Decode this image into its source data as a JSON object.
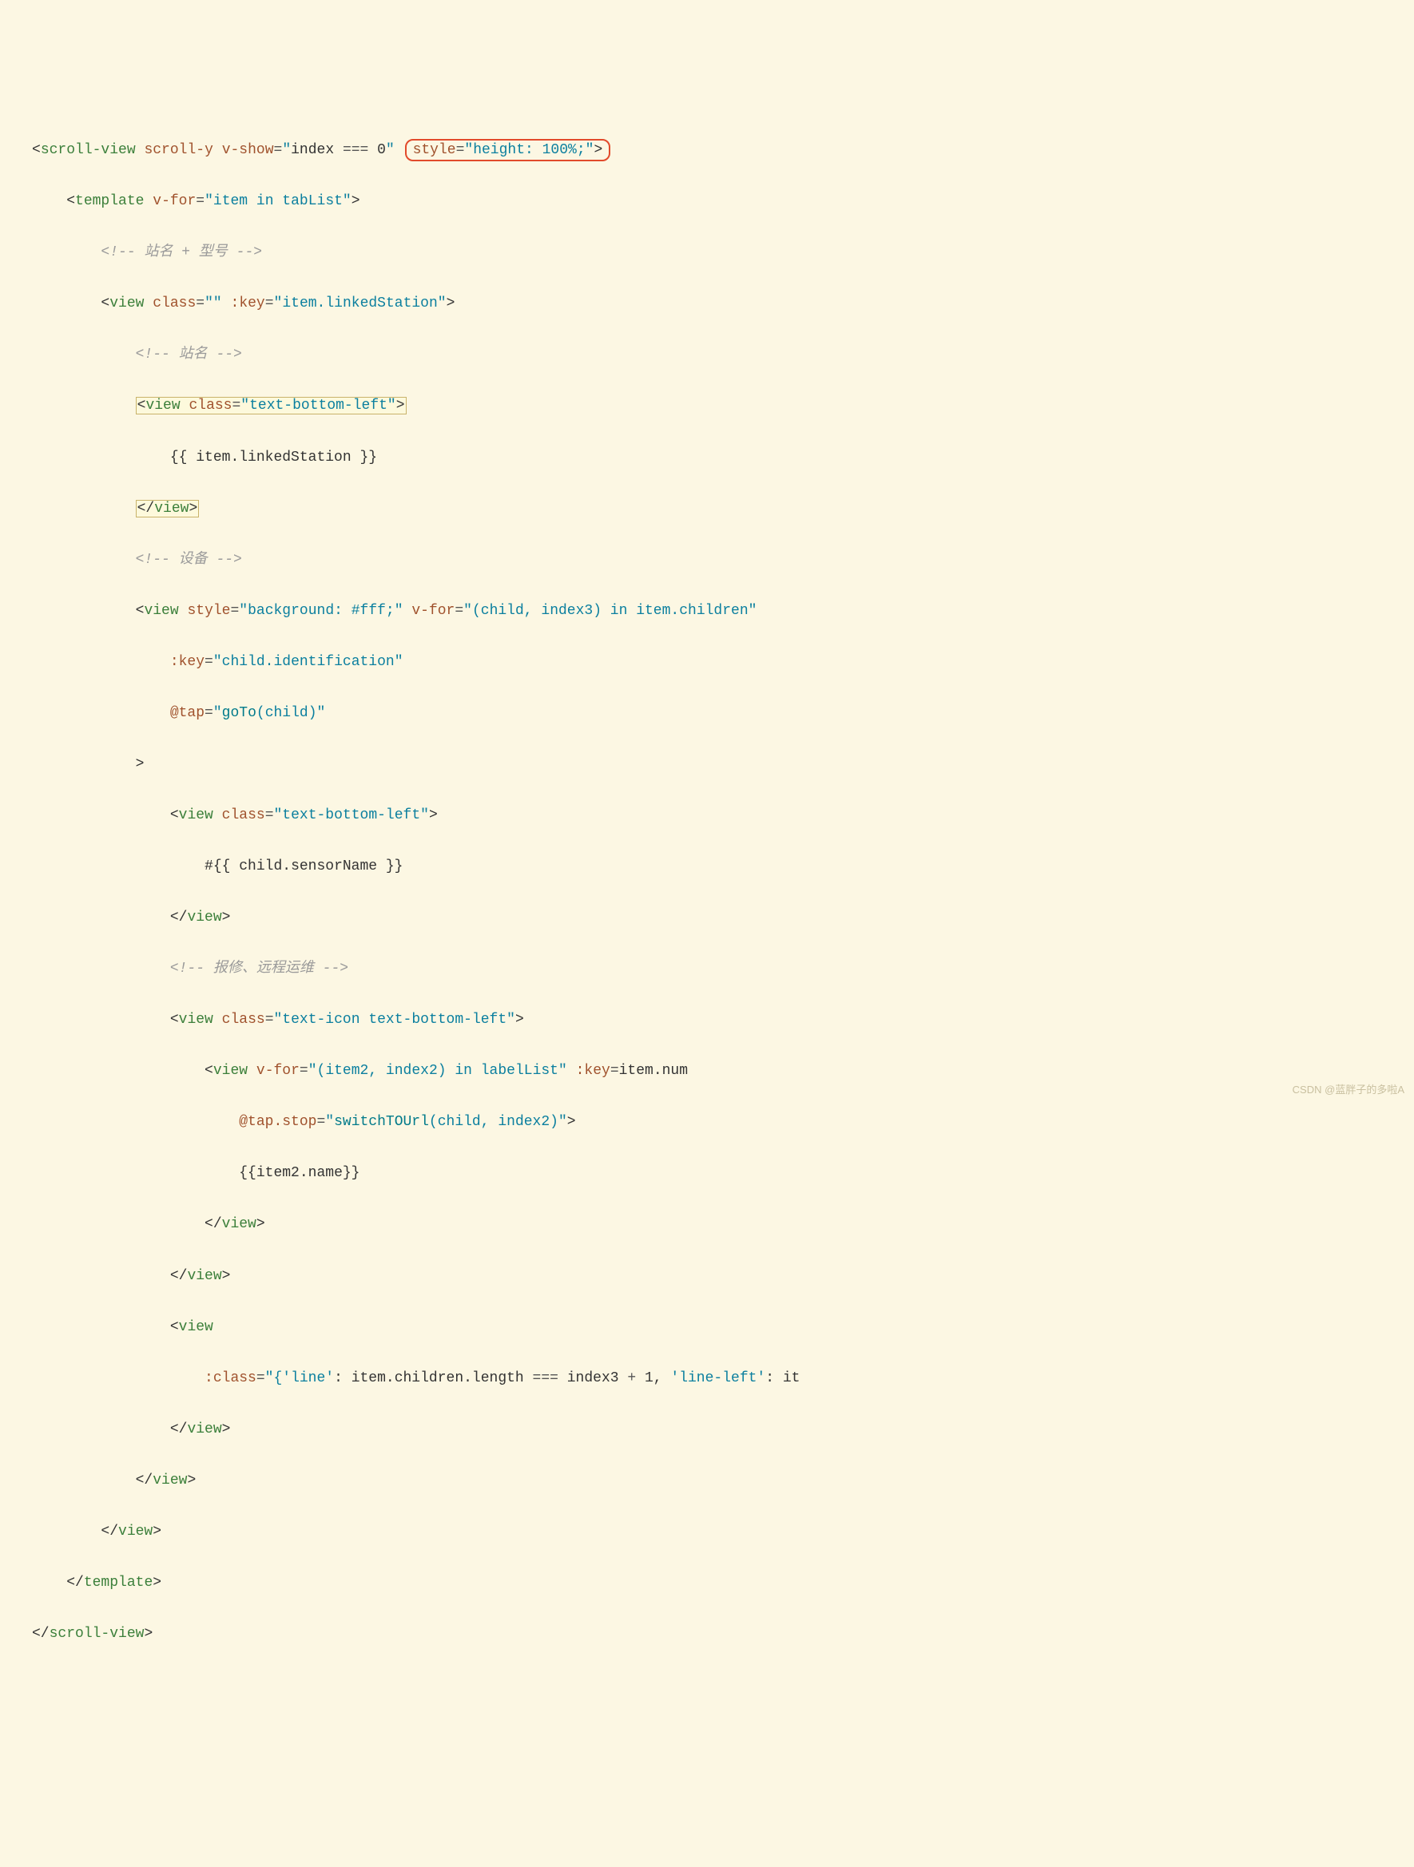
{
  "watermark": "CSDN @蓝胖子的多啦A",
  "code": {
    "l1": {
      "open": "<",
      "tag": "scroll-view",
      "a1": "scroll-y",
      "a2": "v-show",
      "eq": "=",
      "q": "\"",
      "expr1": "index ",
      "expr_op": "===",
      "expr2": " 0",
      "a3": "style",
      "v3": "\"height: 100%;\"",
      "close": ">"
    },
    "l2": {
      "open": "<",
      "tag": "template",
      "a1": "v-for",
      "eq": "=",
      "v1": "\"item in tabList\"",
      "close": ">"
    },
    "l3": {
      "open": "<!--",
      "text": " 站名 + 型号 ",
      "close": "-->"
    },
    "l4": {
      "open": "<",
      "tag": "view",
      "a1": "class",
      "eq": "=",
      "v1": "\"\"",
      "a2": ":key",
      "v2": "\"item.linkedStation\"",
      "close": ">"
    },
    "l5": {
      "open": "<!--",
      "text": " 站名 ",
      "close": "-->"
    },
    "l6": {
      "open": "<",
      "tag": "view",
      "a1": "class",
      "eq": "=",
      "v1": "\"text-bottom-left\"",
      "close": ">"
    },
    "l7": {
      "text": "{{ item.linkedStation }}"
    },
    "l8": {
      "open": "</",
      "tag": "view",
      "close": ">"
    },
    "l9": {
      "open": "<!--",
      "text": " 设备 ",
      "close": "-->"
    },
    "l10": {
      "open": "<",
      "tag": "view",
      "a1": "style",
      "eq": "=",
      "v1": "\"background: #fff;\"",
      "a2": "v-for",
      "v2": "\"(child, index3) in item.children\""
    },
    "l11": {
      "a1": ":key",
      "eq": "=",
      "v1": "\"child.identification\""
    },
    "l12": {
      "a1": "@tap",
      "eq": "=",
      "v1_pre": "\"",
      "fn": "goTo",
      "v1_post": "(child)\""
    },
    "l13": {
      "close": ">"
    },
    "l14": {
      "open": "<",
      "tag": "view",
      "a1": "class",
      "eq": "=",
      "v1": "\"text-bottom-left\"",
      "close": ">"
    },
    "l15": {
      "text": "#{{ child.sensorName }}"
    },
    "l16": {
      "open": "</",
      "tag": "view",
      "close": ">"
    },
    "l17": {
      "open": "<!--",
      "text": " 报修、远程运维 ",
      "close": "-->"
    },
    "l18": {
      "open": "<",
      "tag": "view",
      "a1": "class",
      "eq": "=",
      "v1": "\"text-icon text-bottom-left\"",
      "close": ">"
    },
    "l19": {
      "open": "<",
      "tag": "view",
      "a1": "v-for",
      "eq": "=",
      "v1": "\"(item2, index2) in labelList\"",
      "a2": ":key",
      "v2_pre": "=",
      "v2": "item.num"
    },
    "l20": {
      "a1": "@tap.stop",
      "eq": "=",
      "v1_pre": "\"",
      "fn": "switchTOUrl",
      "v1_post": "(child, index2)\"",
      "close": ">"
    },
    "l21": {
      "text": "{{item2.name}}"
    },
    "l22": {
      "open": "</",
      "tag": "view",
      "close": ">"
    },
    "l23": {
      "open": "</",
      "tag": "view",
      "close": ">"
    },
    "l24": {
      "open": "<",
      "tag": "view"
    },
    "l25": {
      "a1": ":class",
      "eq": "=",
      "v1_pre": "\"{",
      "k1": "'line'",
      "mid1": ": item.children.length ",
      "op1": "===",
      "mid2": " index3 ",
      "plus": "+",
      "one": " 1",
      "comma": ", ",
      "k2": "'line-left'",
      "mid3": ": it"
    },
    "l26": {
      "open": "</",
      "tag": "view",
      "close": ">"
    },
    "l27": {
      "open": "</",
      "tag": "view",
      "close": ">"
    },
    "l28": {
      "open": "</",
      "tag": "view",
      "close": ">"
    },
    "l29": {
      "open": "</",
      "tag": "template",
      "close": ">"
    },
    "l30": {
      "open": "</",
      "tag": "scroll-view",
      "close": ">"
    }
  }
}
